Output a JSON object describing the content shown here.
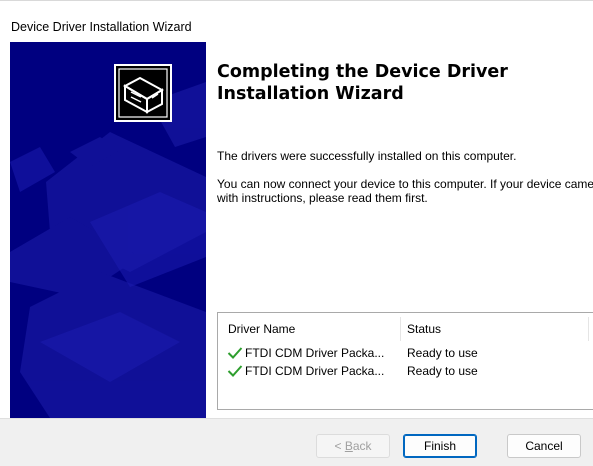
{
  "window": {
    "title": "Device Driver Installation Wizard"
  },
  "content": {
    "heading": "Completing the Device Driver Installation Wizard",
    "para1": "The drivers were successfully installed on this computer.",
    "para2": "You can now connect your device to this computer. If your device came with instructions, please read them first."
  },
  "driver_table": {
    "columns": [
      "Driver Name",
      "Status"
    ],
    "rows": [
      {
        "name": "FTDI CDM Driver Packa...",
        "status": "Ready to use"
      },
      {
        "name": "FTDI CDM Driver Packa...",
        "status": "Ready to use"
      }
    ]
  },
  "buttons": {
    "back_key": "B",
    "back_rest": "ack",
    "back_prefix": "< ",
    "finish": "Finish",
    "cancel": "Cancel"
  },
  "colors": {
    "panel_bg": "#000080",
    "panel_shape": "#1a1aa6",
    "check": "#2e9e2e",
    "default_button_border": "#0067c0"
  },
  "icons": {
    "wizard": "computer-box-icon",
    "check": "checkmark-icon"
  }
}
